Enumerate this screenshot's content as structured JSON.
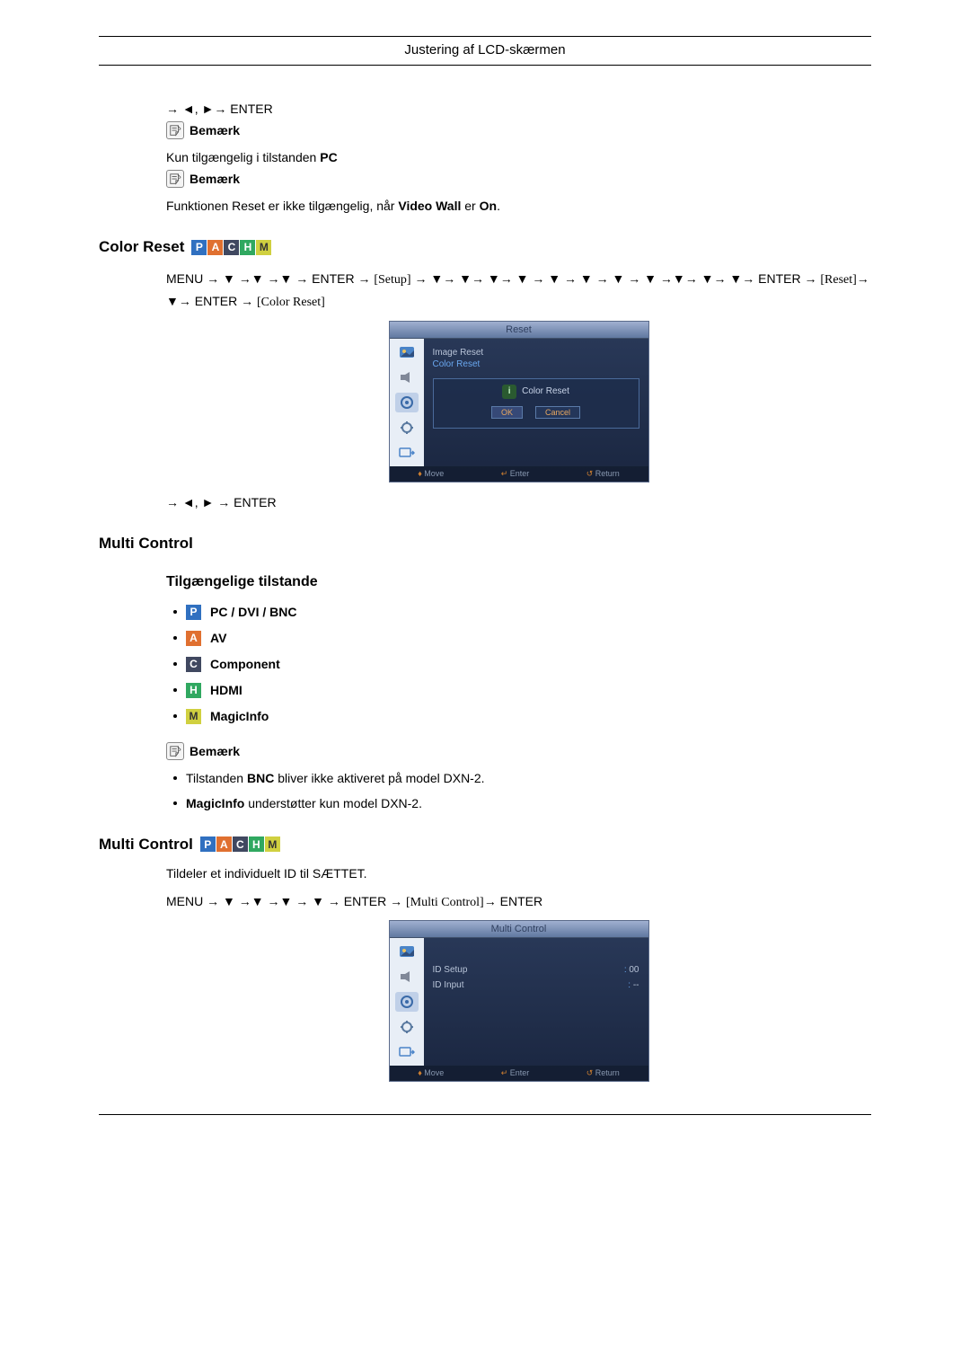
{
  "page_header": "Justering af LCD-skærmen",
  "intro_nav": "→ ◄, ►→ ENTER",
  "note_label": "Bemærk",
  "intro_text_1a": "Kun tilgængelig i tilstanden ",
  "intro_text_1b": "PC",
  "intro_text_2a": "Funktionen Reset er ikke tilgængelig, når ",
  "intro_text_2b": "Video Wall",
  "intro_text_2c": " er ",
  "intro_text_2d": "On",
  "intro_text_2e": ".",
  "color_reset": {
    "heading": "Color Reset",
    "path_parts": {
      "p1": "MENU → ▼ →▼ →▼ → ENTER → ",
      "setup": "[Setup]",
      "p2": " → ▼→ ▼→ ▼→ ▼ → ▼ → ▼ → ▼ → ▼ →▼→ ▼→ ▼→ ENTER → ",
      "reset": "[Reset]",
      "p3": "→ ▼→ ENTER → ",
      "cr": "[Color Reset]"
    },
    "osd": {
      "title": "Reset",
      "item1": "Image Reset",
      "item2": "Color Reset",
      "dialog_title": "Color Reset",
      "btn_ok": "OK",
      "btn_cancel": "Cancel",
      "footer_move": "Move",
      "footer_enter": "Enter",
      "footer_return": "Return"
    },
    "post_nav": "→ ◄, ► → ENTER"
  },
  "multi_control": {
    "heading": "Multi Control",
    "sub": "Tilgængelige tilstande",
    "modes": [
      {
        "badge": "P",
        "cls": "badge-P",
        "label": "PC / DVI / BNC"
      },
      {
        "badge": "A",
        "cls": "badge-A",
        "label": "AV"
      },
      {
        "badge": "C",
        "cls": "badge-C",
        "label": "Component"
      },
      {
        "badge": "H",
        "cls": "badge-H",
        "label": "HDMI"
      },
      {
        "badge": "M",
        "cls": "badge-M",
        "label": "MagicInfo"
      }
    ],
    "bullets": [
      {
        "pre": "Tilstanden ",
        "bold": "BNC",
        "post": " bliver ikke aktiveret på model DXN-2."
      },
      {
        "pre": "",
        "bold": "MagicInfo",
        "post": " understøtter kun model DXN-2."
      }
    ]
  },
  "multi_control2": {
    "heading": "Multi Control",
    "desc": "Tildeler et individuelt ID til SÆTTET.",
    "path_parts": {
      "p1": "MENU → ▼ →▼ →▼ → ▼ → ENTER → ",
      "mc": "[Multi Control]",
      "p2": "→ ENTER"
    },
    "osd": {
      "title": "Multi Control",
      "row1_label": "ID Setup",
      "row1_val": "00",
      "row2_label": "ID Input",
      "row2_val": "--",
      "footer_move": "Move",
      "footer_enter": "Enter",
      "footer_return": "Return"
    }
  }
}
